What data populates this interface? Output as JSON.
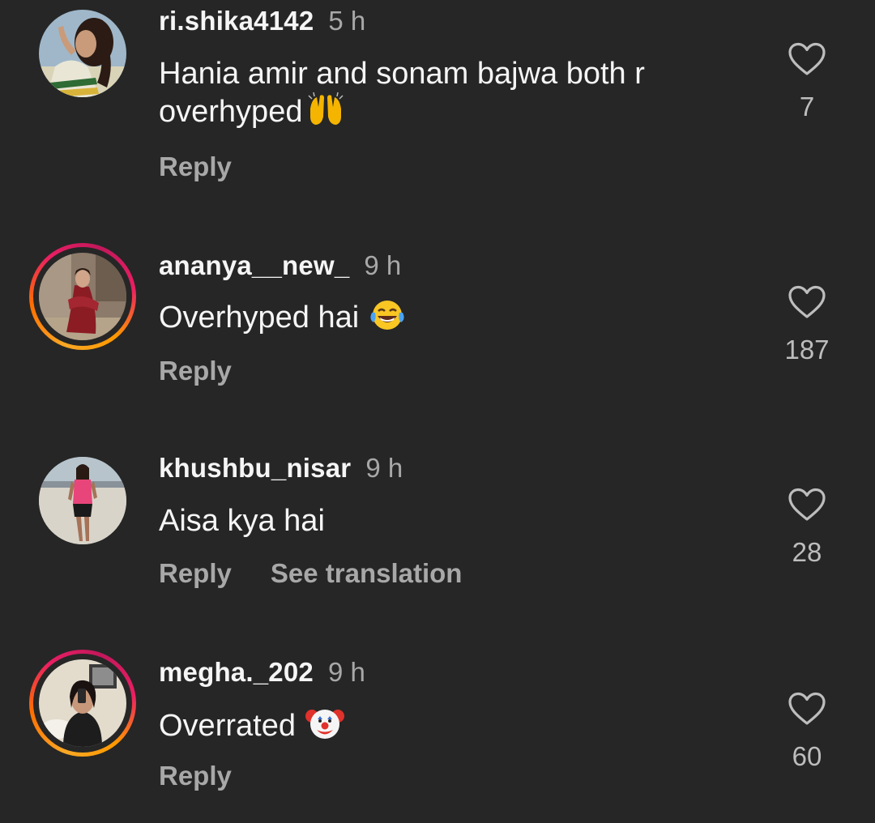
{
  "comments": [
    {
      "username": "ri.shika4142",
      "time": "5 h",
      "text": "Hania amir and sonam bajwa both r overhyped",
      "emoji": "raised-hands",
      "reply_label": "Reply",
      "likes": "7",
      "story_ring": false
    },
    {
      "username": "ananya__new_",
      "time": "9 h",
      "text": "Overhyped hai",
      "emoji": "tears-of-joy",
      "reply_label": "Reply",
      "likes": "187",
      "story_ring": true
    },
    {
      "username": "khushbu_nisar",
      "time": "9 h",
      "text": "Aisa kya hai",
      "reply_label": "Reply",
      "translation_label": "See translation",
      "likes": "28",
      "story_ring": false
    },
    {
      "username": "megha._202",
      "time": "9 h",
      "text": "Overrated",
      "emoji": "clown-face",
      "reply_label": "Reply",
      "likes": "60",
      "story_ring": true
    }
  ],
  "icons": {
    "like": "heart-outline-icon"
  },
  "colors": {
    "background": "#262626",
    "text": "#f5f5f5",
    "secondary": "#a8a8a8",
    "story_ring": [
      "#f9a825",
      "#e91e63"
    ]
  }
}
